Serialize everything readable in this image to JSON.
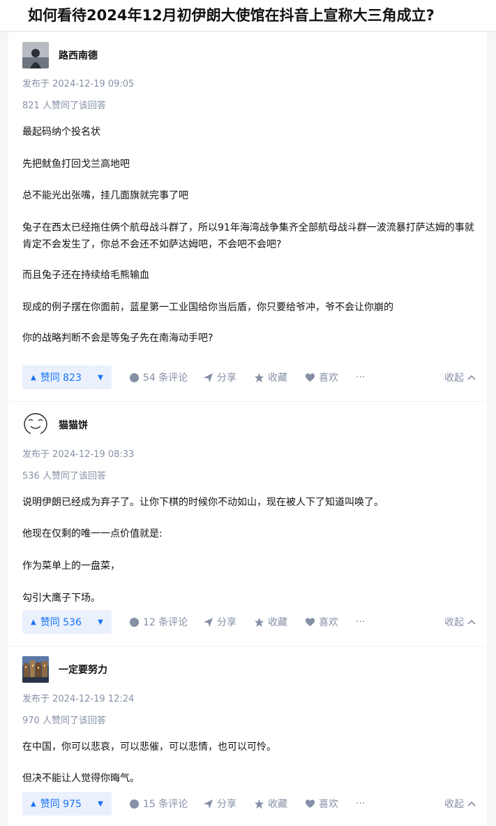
{
  "question": {
    "title": "如何看待2024年12月初伊朗大使馆在抖音上宣称大三角成立?"
  },
  "answers": [
    {
      "author": "路西南德",
      "published": "发布于 2024-12-19 09:05",
      "agree_text": "821 人赞同了该回答",
      "paragraphs": [
        "最起码纳个投名状",
        "先把鱿鱼打回戈兰高地吧",
        "总不能光出张嘴，挂几面旗就完事了吧",
        "兔子在西太已经拖住俩个航母战斗群了，所以91年海湾战争集齐全部航母战斗群一波流暴打萨达姆的事就肯定不会发生了，你总不会还不如萨达姆吧，不会吧不会吧?",
        "而且兔子还在持续给毛熊输血",
        "现成的例子摆在你面前，蓝星第一工业国给你当后盾，你只要给爷冲，爷不会让你崩的",
        "你的战略判断不会是等兔子先在南海动手吧?"
      ],
      "vote_label": "赞同 823",
      "comments": "54 条评论"
    },
    {
      "author": "猫猫饼",
      "published": "发布于 2024-12-19 08:33",
      "agree_text": "536 人赞同了该回答",
      "paragraphs": [
        "说明伊朗已经成为弃子了。让你下棋的时候你不动如山，现在被人下了知道叫唤了。",
        "他现在仅剩的唯一一点价值就是:",
        "作为菜单上的一盘菜，",
        "勾引大鹰子下场。"
      ],
      "vote_label": "赞同 536",
      "comments": "12 条评论"
    },
    {
      "author": "一定要努力",
      "published": "发布于 2024-12-19 12:24",
      "agree_text": "970 人赞同了该回答",
      "paragraphs": [
        "在中国，你可以悲哀，可以悲催，可以悲情，也可以可怜。",
        "但决不能让人觉得你晦气。"
      ],
      "vote_label": "赞同 975",
      "comments": "15 条评论"
    }
  ],
  "actions": {
    "share": "分享",
    "favorite": "收藏",
    "like": "喜欢",
    "more": "···",
    "collapse": "收起"
  },
  "icons": [
    "caret-up-icon",
    "caret-down-icon",
    "comment-icon",
    "share-icon",
    "star-icon",
    "heart-icon",
    "chevron-up-icon"
  ],
  "colors": {
    "accent": "#1772f6",
    "vote_bg": "#eaf1fd",
    "meta": "#8590a6",
    "text": "#121212"
  }
}
